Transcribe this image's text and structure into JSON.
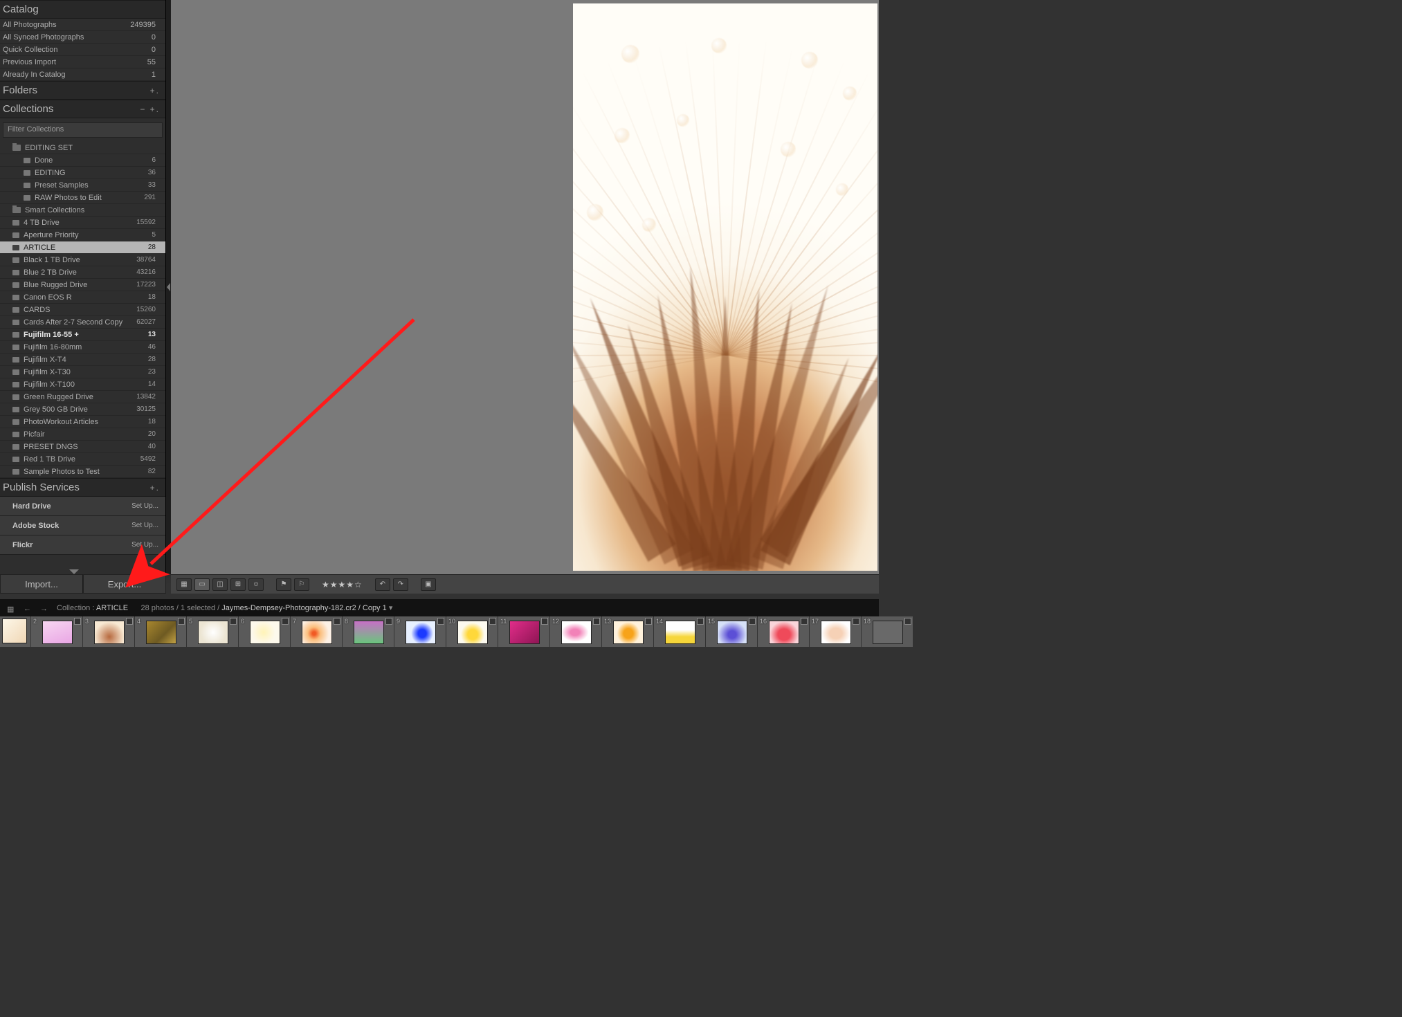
{
  "sidebar": {
    "catalog": {
      "title": "Catalog",
      "rows": [
        {
          "label": "All Photographs",
          "count": "249395"
        },
        {
          "label": "All Synced Photographs",
          "count": "0"
        },
        {
          "label": "Quick Collection",
          "count": "0"
        },
        {
          "label": "Previous Import",
          "count": "55"
        },
        {
          "label": "Already In Catalog",
          "count": "1"
        }
      ]
    },
    "folders": {
      "title": "Folders",
      "btns": "+."
    },
    "collections": {
      "title": "Collections",
      "btns": "− +.",
      "filter_placeholder": "Filter Collections",
      "items": [
        {
          "type": "set",
          "depth": 1,
          "label": "EDITING SET",
          "count": ""
        },
        {
          "type": "coll",
          "depth": 2,
          "label": "Done",
          "count": "6"
        },
        {
          "type": "coll",
          "depth": 2,
          "label": "EDITING",
          "count": "36"
        },
        {
          "type": "coll",
          "depth": 2,
          "label": "Preset Samples",
          "count": "33"
        },
        {
          "type": "coll",
          "depth": 2,
          "label": "RAW Photos to Edit",
          "count": "291"
        },
        {
          "type": "set",
          "depth": 1,
          "label": "Smart Collections",
          "count": ""
        },
        {
          "type": "coll",
          "depth": 1,
          "label": "4 TB Drive",
          "count": "15592"
        },
        {
          "type": "coll",
          "depth": 1,
          "label": "Aperture Priority",
          "count": "5"
        },
        {
          "type": "coll",
          "depth": 1,
          "label": "ARTICLE",
          "count": "28",
          "selected": true
        },
        {
          "type": "coll",
          "depth": 1,
          "label": "Black 1 TB Drive",
          "count": "38764"
        },
        {
          "type": "coll",
          "depth": 1,
          "label": "Blue 2 TB Drive",
          "count": "43216"
        },
        {
          "type": "coll",
          "depth": 1,
          "label": "Blue Rugged Drive",
          "count": "17223"
        },
        {
          "type": "coll",
          "depth": 1,
          "label": "Canon EOS R",
          "count": "18"
        },
        {
          "type": "coll",
          "depth": 1,
          "label": "CARDS",
          "count": "15260"
        },
        {
          "type": "coll",
          "depth": 1,
          "label": "Cards After 2-7 Second Copy",
          "count": "62027"
        },
        {
          "type": "coll",
          "depth": 1,
          "label": "Fujifilm 16-55  +",
          "count": "13",
          "bold": true
        },
        {
          "type": "coll",
          "depth": 1,
          "label": "Fujifilm 16-80mm",
          "count": "46"
        },
        {
          "type": "coll",
          "depth": 1,
          "label": "Fujifilm X-T4",
          "count": "28"
        },
        {
          "type": "coll",
          "depth": 1,
          "label": "Fujifilm X-T30",
          "count": "23"
        },
        {
          "type": "coll",
          "depth": 1,
          "label": "Fujifilm X-T100",
          "count": "14"
        },
        {
          "type": "coll",
          "depth": 1,
          "label": "Green Rugged Drive",
          "count": "13842"
        },
        {
          "type": "coll",
          "depth": 1,
          "label": "Grey 500 GB Drive",
          "count": "30125"
        },
        {
          "type": "coll",
          "depth": 1,
          "label": "PhotoWorkout Articles",
          "count": "18"
        },
        {
          "type": "coll",
          "depth": 1,
          "label": "Picfair",
          "count": "20"
        },
        {
          "type": "coll",
          "depth": 1,
          "label": "PRESET DNGS",
          "count": "40"
        },
        {
          "type": "coll",
          "depth": 1,
          "label": "Red 1 TB Drive",
          "count": "5492"
        },
        {
          "type": "coll",
          "depth": 1,
          "label": "Sample Photos to Test",
          "count": "82"
        }
      ]
    },
    "publish": {
      "title": "Publish Services",
      "btns": "+.",
      "rows": [
        {
          "label": "Hard Drive",
          "action": "Set Up..."
        },
        {
          "label": "Adobe Stock",
          "action": "Set Up..."
        },
        {
          "label": "Flickr",
          "action": "Set Up..."
        }
      ]
    }
  },
  "port_bar": {
    "import_label": "Import...",
    "export_label": "Export..."
  },
  "toolbar": {
    "stars": "★★★★☆"
  },
  "strip": {
    "crumb_prefix": "Collection : ",
    "crumb_name": "ARTICLE",
    "meta": "28 photos / 1 selected /",
    "filename": "Jaymes-Dempsey-Photography-182.cr2 / Copy 1",
    "chevron": "▾"
  },
  "thumbs": [
    {
      "num": "",
      "bg": "linear-gradient(135deg,#fdf7e9,#f0d7b5)"
    },
    {
      "num": "2",
      "bg": "linear-gradient(160deg,#f7d6f2,#e9a6e4)"
    },
    {
      "num": "3",
      "bg": "radial-gradient(circle at 50% 70%,#b76a3f,#f8e9d3 70%)"
    },
    {
      "num": "4",
      "bg": "linear-gradient(135deg,#a8872f,#6e5a22 60%,#c3a244)"
    },
    {
      "num": "5",
      "bg": "radial-gradient(circle at 50% 50%,#fff,#ece5d3 70%)"
    },
    {
      "num": "6",
      "bg": "radial-gradient(circle at 45% 50%,#fff3b7,#fdf9ec 60%)"
    },
    {
      "num": "7",
      "bg": "radial-gradient(circle at 40% 55%,#f15a24 8%,#fbbf7e 30%,#fdf1e6 70%)"
    },
    {
      "num": "8",
      "bg": "linear-gradient(180deg,#c770c6 0%,#6ac57d 100%)"
    },
    {
      "num": "9",
      "bg": "radial-gradient(circle at 55% 55%,#1c3aff 20%,#e7f0ff 55%)"
    },
    {
      "num": "10",
      "bg": "radial-gradient(circle at 50% 60%,#ffd83a 25%,#fcfaef 60%)"
    },
    {
      "num": "11",
      "bg": "linear-gradient(135deg,#e22d8a,#8e1554)"
    },
    {
      "num": "12",
      "bg": "radial-gradient(ellipse at 45% 50%,#f282b8 20%,#fff 60%)"
    },
    {
      "num": "13",
      "bg": "radial-gradient(circle at 50% 55%,#f7a31a 25%,#fff2dc 60%)"
    },
    {
      "num": "14",
      "bg": "linear-gradient(180deg,#fff 40%,#f6d63a 70%)"
    },
    {
      "num": "15",
      "bg": "radial-gradient(ellipse at 50% 60%,#5c4fd6 20%,#d6e0f7 70%)"
    },
    {
      "num": "16",
      "bg": "radial-gradient(ellipse at 50% 60%,#ef4a5a 30%,#f9d5da 70%)"
    },
    {
      "num": "17",
      "bg": "radial-gradient(ellipse at 50% 55%,#f6d1b6 30%,#fff 70%)"
    },
    {
      "num": "18",
      "bg": "#696969"
    }
  ]
}
